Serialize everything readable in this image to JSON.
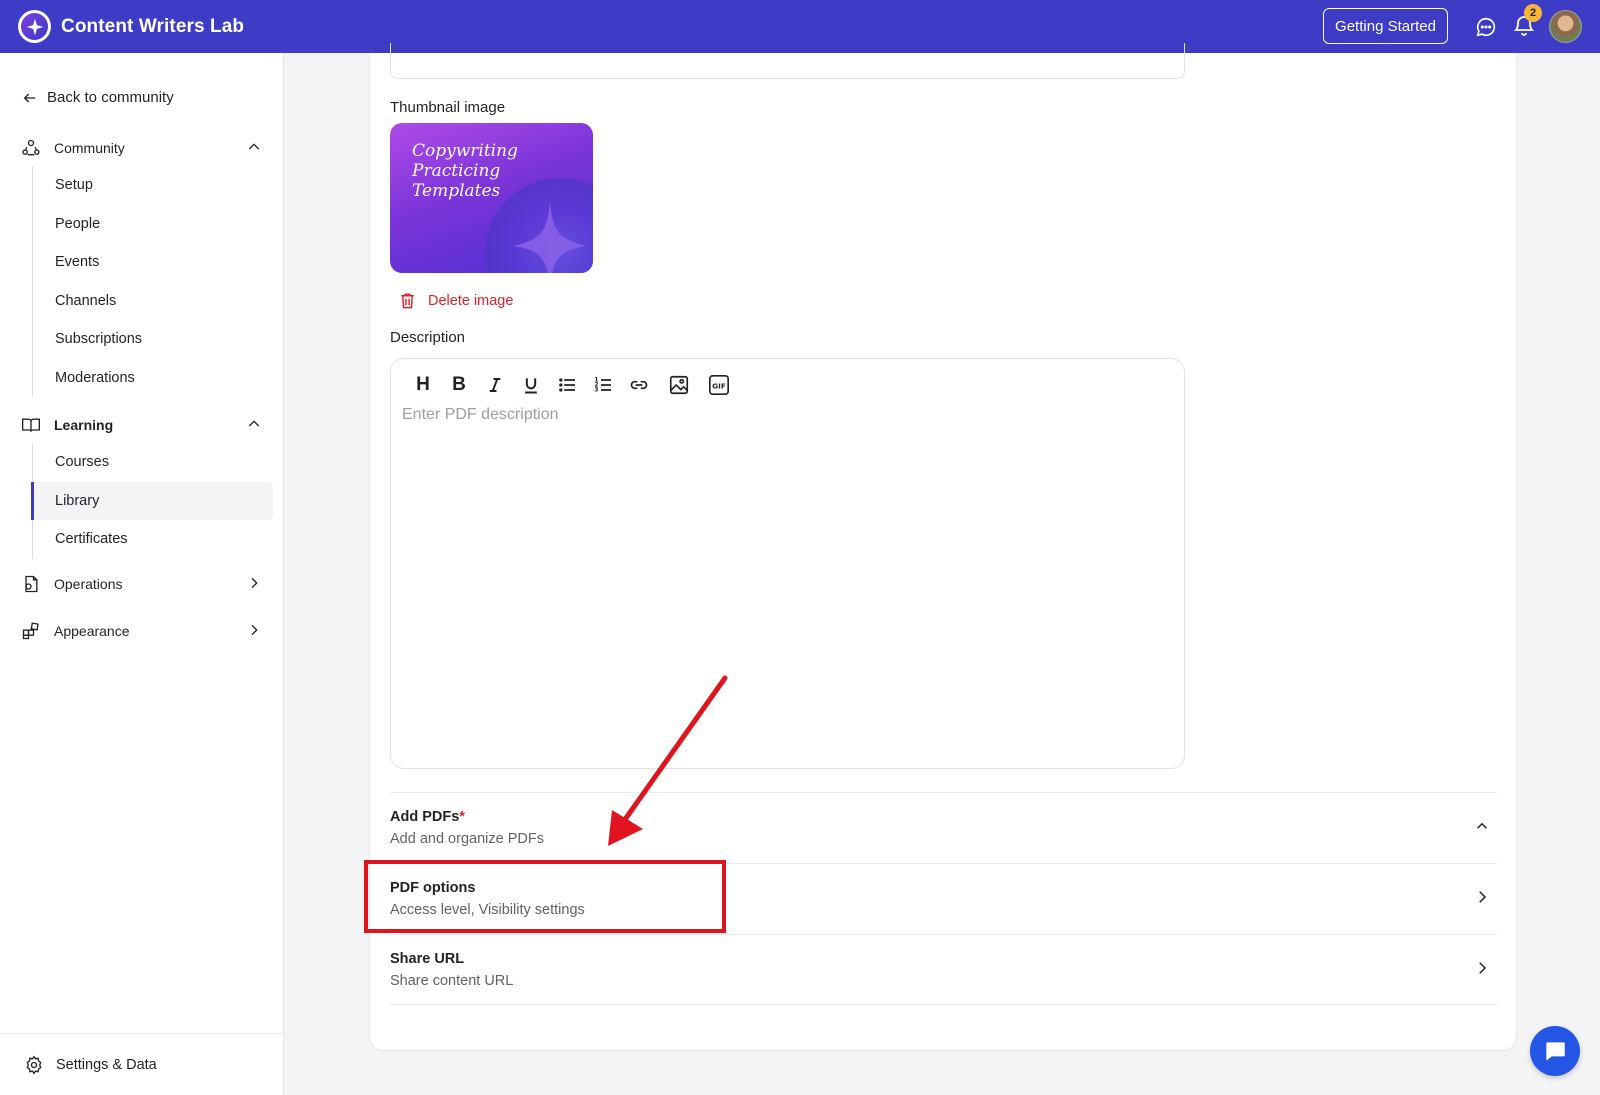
{
  "app": {
    "title": "Content Writers Lab"
  },
  "topbar": {
    "getting_started_label": "Getting Started",
    "notification_count": "2",
    "icons": [
      "chat-icon",
      "bell-icon",
      "avatar"
    ]
  },
  "sidebar": {
    "back_label": "Back to community",
    "groups": [
      {
        "label": "Community",
        "icon": "community-icon",
        "expanded": true,
        "items": [
          "Setup",
          "People",
          "Events",
          "Channels",
          "Subscriptions",
          "Moderations"
        ]
      },
      {
        "label": "Learning",
        "icon": "book-icon",
        "expanded": true,
        "items": [
          "Courses",
          "Library",
          "Certificates"
        ],
        "active_item": "Library"
      },
      {
        "label": "Operations",
        "icon": "operations-icon",
        "expanded": false
      },
      {
        "label": "Appearance",
        "icon": "appearance-icon",
        "expanded": false
      }
    ],
    "footer_label": "Settings & Data"
  },
  "form": {
    "thumbnail_label": "Thumbnail image",
    "thumbnail_text": [
      "Copywriting",
      "Practicing",
      "Templates"
    ],
    "delete_image_label": "Delete image",
    "description_label": "Description",
    "description_placeholder": "Enter PDF description",
    "toolbar": [
      "H",
      "B",
      "I",
      "U",
      "bullet-list",
      "numbered-list",
      "link",
      "image",
      "GIF"
    ],
    "gif_label": "GIF"
  },
  "sections": [
    {
      "title": "Add PDFs",
      "required_mark": "*",
      "subtitle": "Add and organize PDFs",
      "state": "expanded"
    },
    {
      "title": "PDF options",
      "subtitle": "Access level, Visibility settings",
      "state": "collapsed",
      "highlighted": true
    },
    {
      "title": "Share URL",
      "subtitle": "Share content URL",
      "state": "collapsed"
    }
  ],
  "colors": {
    "brand": "#3e3bc6",
    "danger": "#e0202a",
    "annotation": "#e0141e",
    "fab": "#2456e6"
  }
}
